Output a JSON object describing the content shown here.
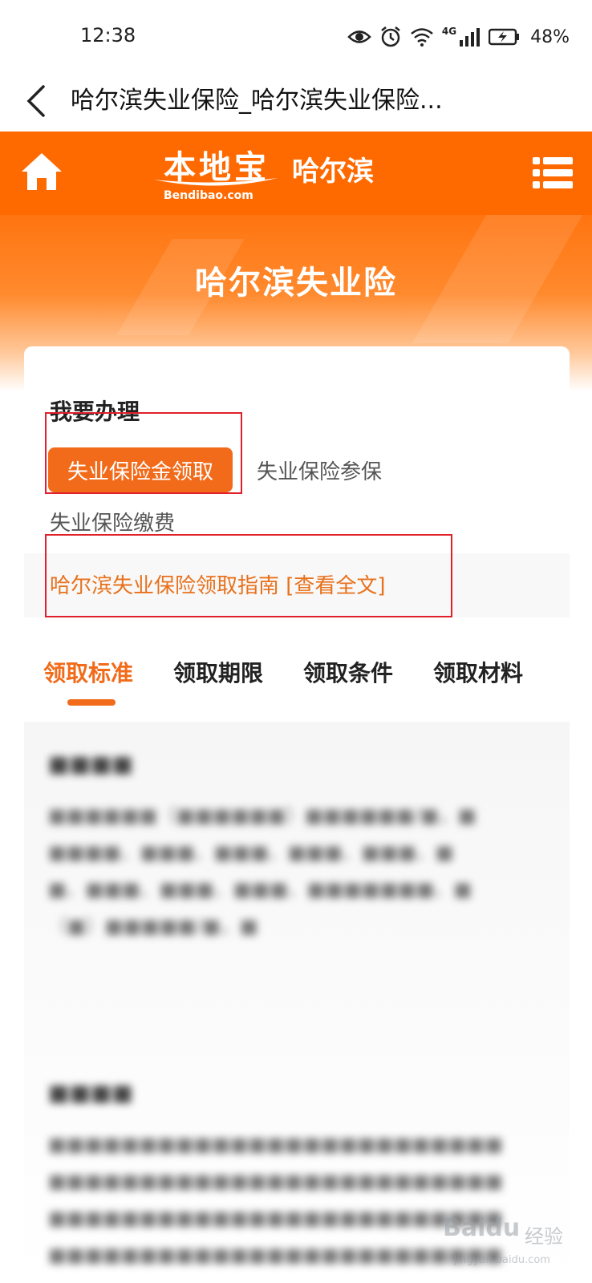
{
  "status_bar": {
    "time": "12:38",
    "network": "4G",
    "battery": "48%",
    "icons": [
      "eye-icon",
      "alarm-icon",
      "wifi-icon",
      "signal-icon",
      "battery-icon"
    ]
  },
  "browser": {
    "title": "哈尔滨失业保险_哈尔滨失业保险..."
  },
  "header": {
    "logo_main": "本地宝",
    "logo_sub": "Bendibao.com",
    "city": "哈尔滨",
    "brand_color": "#ff6a00"
  },
  "banner": {
    "title": "哈尔滨失业险"
  },
  "card": {
    "section_label": "我要办理",
    "services": {
      "primary": "失业保险金领取",
      "enroll": "失业保险参保",
      "pay": "失业保险缴费"
    },
    "guide_link": "哈尔滨失业保险领取指南 [查看全文]"
  },
  "tabs": [
    {
      "label": "领取标准",
      "active": true
    },
    {
      "label": "领取期限",
      "active": false
    },
    {
      "label": "领取条件",
      "active": false
    },
    {
      "label": "领取材料",
      "active": false
    }
  ],
  "watermark": {
    "brand": "Baidu",
    "cn": "经验",
    "url": "jingyan.baidu.com"
  },
  "accent_color": "#f16b1a",
  "annotation_color": "#e0202a"
}
